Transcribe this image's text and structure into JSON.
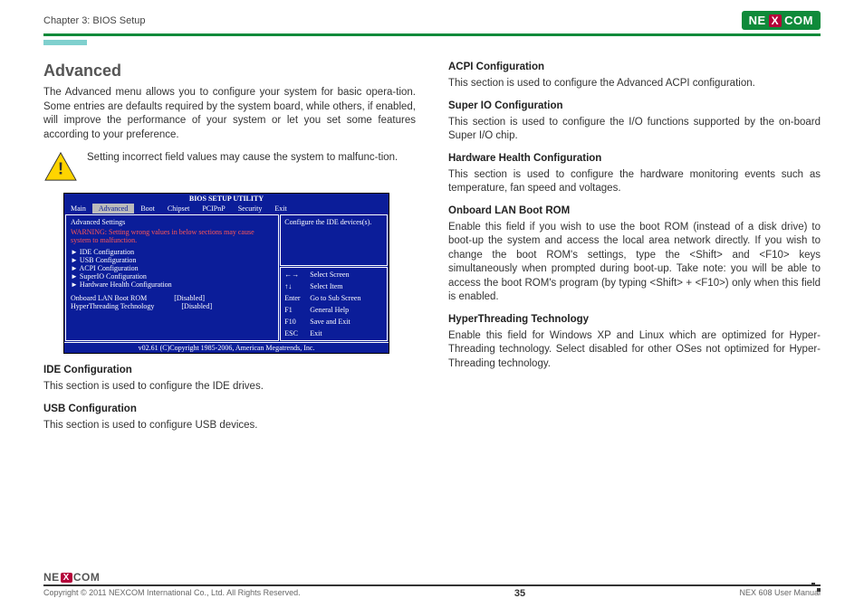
{
  "header": {
    "chapter": "Chapter 3: BIOS Setup",
    "brand_left": "NE",
    "brand_x": "X",
    "brand_right": "COM"
  },
  "left": {
    "title": "Advanced",
    "intro": "The Advanced menu allows you to configure your system for basic opera-tion. Some entries are defaults required by the system board, while others, if enabled, will improve the performance of your system or let you set some features according to your preference.",
    "warning": "Setting incorrect field values may cause the system to malfunc-tion.",
    "ide_h": "IDE Configuration",
    "ide_p": "This section is used to configure the IDE drives.",
    "usb_h": "USB Configuration",
    "usb_p": "This section is used to configure USB devices."
  },
  "right": {
    "acpi_h": "ACPI Configuration",
    "acpi_p": "This section is used to configure the Advanced ACPI configuration.",
    "sio_h": "Super IO Configuration",
    "sio_p": "This section is used to configure the I/O functions supported by the on-board Super I/O chip.",
    "hw_h": "Hardware Health Configuration",
    "hw_p": "This section is used to configure the hardware monitoring events such as temperature, fan speed and voltages.",
    "lan_h": "Onboard LAN Boot ROM",
    "lan_p": "Enable this field if you wish to use the boot ROM (instead of a disk drive) to boot-up the system and access the local area network directly. If you wish to change the boot ROM's settings, type the <Shift> and <F10> keys simultaneously when prompted during boot-up. Take note: you will be able to access the boot ROM's program (by typing <Shift> + <F10>) only when this field is enabled.",
    "ht_h": "HyperThreading Technology",
    "ht_p": "Enable this field for Windows XP and Linux which are optimized for Hyper-Threading technology. Select disabled for other OSes not optimized for Hyper-Threading technology."
  },
  "bios": {
    "title": "BIOS SETUP UTILITY",
    "tabs": [
      "Main",
      "Advanced",
      "Boot",
      "Chipset",
      "PCIPnP",
      "Security",
      "Exit"
    ],
    "active_tab_index": 1,
    "heading": "Advanced Settings",
    "warn": "WARNING:  Setting wrong values in below sections may cause system to malfunction.",
    "menu": [
      "IDE Configuration",
      "USB Configuration",
      "ACPI Configuration",
      "SuperIO Configuration",
      "Hardware Health Configuration"
    ],
    "rows": [
      {
        "k": "Onboard LAN Boot ROM",
        "v": "[Disabled]"
      },
      {
        "k": "HyperThreading Technology",
        "v": "[Disabled]"
      }
    ],
    "help": "Configure the IDE devices(s).",
    "keys": [
      {
        "k": "←→",
        "v": "Select Screen"
      },
      {
        "k": "↑↓",
        "v": "Select Item"
      },
      {
        "k": "Enter",
        "v": "Go to Sub Screen"
      },
      {
        "k": "F1",
        "v": "General Help"
      },
      {
        "k": "F10",
        "v": "Save and Exit"
      },
      {
        "k": "ESC",
        "v": "Exit"
      }
    ],
    "foot": "v02.61 (C)Copyright 1985-2006, American Megatrends, Inc."
  },
  "footer": {
    "copyright": "Copyright © 2011 NEXCOM International Co., Ltd. All Rights Reserved.",
    "page": "35",
    "manual": "NEX 608 User Manual",
    "brand_left": "NE",
    "brand_x": "X",
    "brand_right": "COM"
  }
}
